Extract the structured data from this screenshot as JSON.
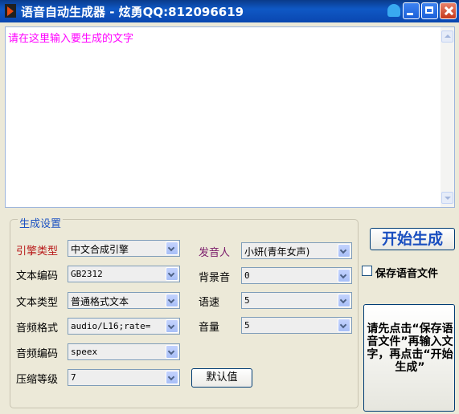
{
  "window": {
    "title": "语音自动生成器 - 炫勇QQ:812096619"
  },
  "icons": [
    "app-icon",
    "skin-icon",
    "minimize-icon",
    "maximize-icon",
    "close-icon",
    "scroll-up-icon",
    "scroll-down-icon",
    "dropdown-arrow-icon"
  ],
  "editor": {
    "placeholder": "请在这里输入要生成的文字"
  },
  "settings": {
    "group_title": "生成设置",
    "engine_type": {
      "label": "引擎类型",
      "value": "中文合成引擎"
    },
    "text_encoding": {
      "label": "文本编码",
      "value": "GB2312"
    },
    "text_type": {
      "label": "文本类型",
      "value": "普通格式文本"
    },
    "audio_format": {
      "label": "音频格式",
      "value": "audio/L16;rate="
    },
    "audio_codec": {
      "label": "音频编码",
      "value": "speex"
    },
    "compression_level": {
      "label": "压缩等级",
      "value": "7"
    },
    "speaker": {
      "label": "发音人",
      "value": "小妍(青年女声)"
    },
    "background_sound": {
      "label": "背景音",
      "value": "0"
    },
    "speed": {
      "label": "语速",
      "value": "5"
    },
    "volume": {
      "label": "音量",
      "value": "5"
    },
    "default_button": "默认值"
  },
  "actions": {
    "start_button": "开始生成",
    "save_checkbox_label": "保存语音文件",
    "save_checked": false,
    "hint": "请先点击“保存语音文件”再输入文字，再点击“开始生成”"
  }
}
